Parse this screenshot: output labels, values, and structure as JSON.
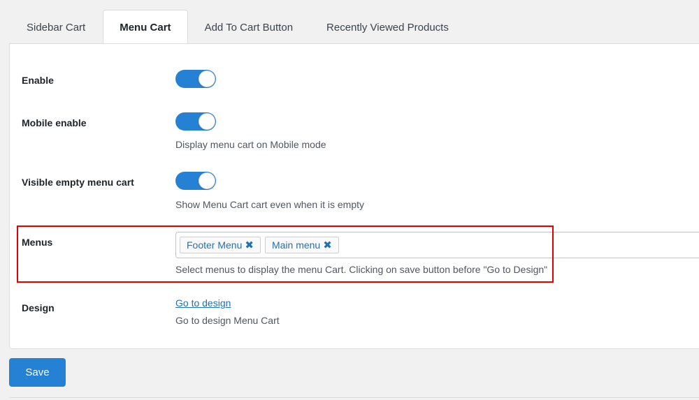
{
  "tabs": [
    {
      "label": "Sidebar Cart",
      "active": false
    },
    {
      "label": "Menu Cart",
      "active": true
    },
    {
      "label": "Add To Cart Button",
      "active": false
    },
    {
      "label": "Recently Viewed Products",
      "active": false
    }
  ],
  "settings": {
    "enable": {
      "label": "Enable",
      "on": true
    },
    "mobile_enable": {
      "label": "Mobile enable",
      "on": true,
      "description": "Display menu cart on Mobile mode"
    },
    "visible_empty": {
      "label": "Visible empty menu cart",
      "on": true,
      "description": "Show Menu Cart cart even when it is empty"
    },
    "menus": {
      "label": "Menus",
      "selected": [
        "Footer Menu",
        "Main menu"
      ],
      "remove_icon": "x-icon",
      "description": "Select menus to display the menu Cart. Clicking on save button before \"Go to Design\""
    },
    "design": {
      "label": "Design",
      "link": "Go to design",
      "description": "Go to design Menu Cart"
    }
  },
  "save_label": "Save",
  "colors": {
    "accent": "#2581d3",
    "link": "#2271b1",
    "highlight": "#e00000"
  }
}
